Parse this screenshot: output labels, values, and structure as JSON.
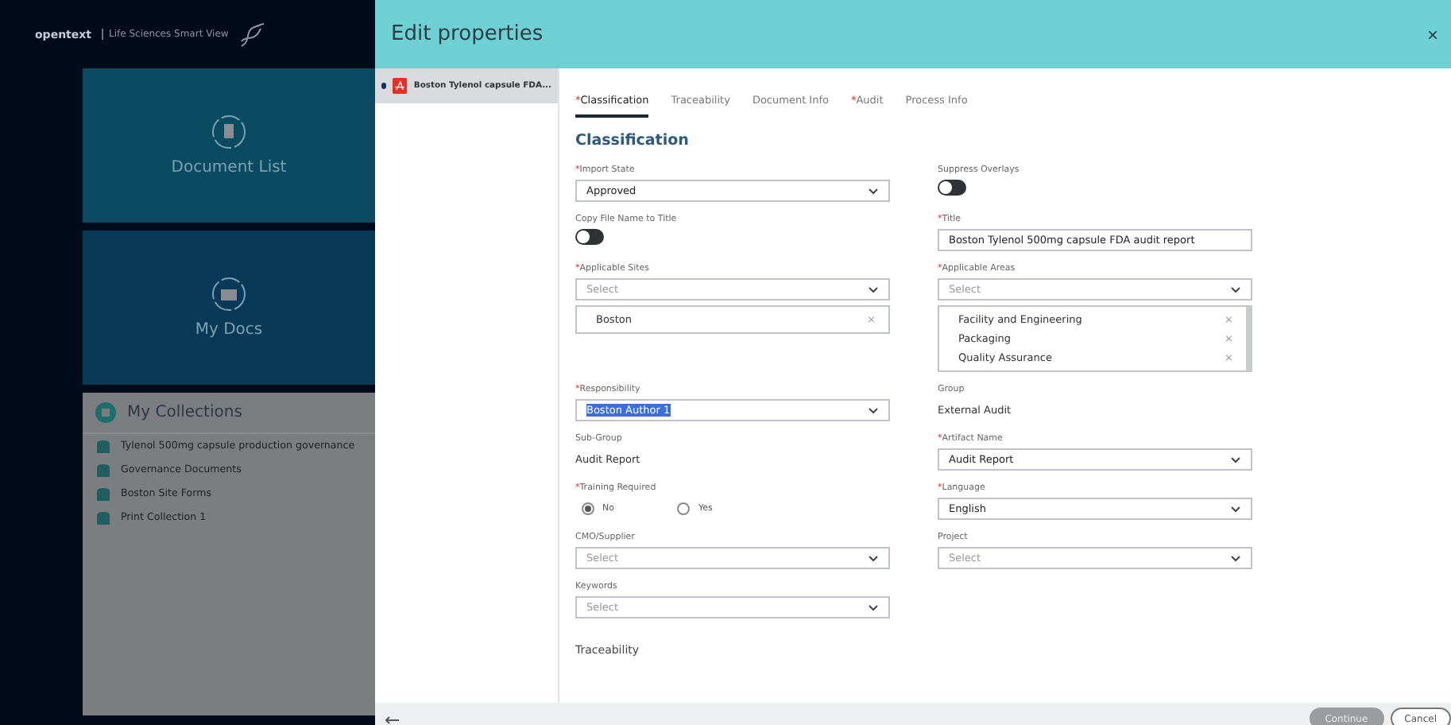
{
  "app": {
    "brand": "opentext",
    "product": "Life Sciences Smart View",
    "tiles": [
      {
        "label": "Document List",
        "kind": "list"
      },
      {
        "label": "My Docs",
        "kind": "folder"
      }
    ],
    "collections": {
      "title": "My Collections",
      "items": [
        "Tylenol 500mg capsule production governance",
        "Governance Documents",
        "Boston Site Forms",
        "Print Collection 1"
      ]
    }
  },
  "dialog": {
    "title": "Edit properties",
    "close": "×",
    "documents": [
      {
        "name": "Boston Tylenol capsule FDA...",
        "selected": true
      }
    ],
    "tabs": [
      {
        "mark": "*",
        "label": "Classification",
        "selected": true
      },
      {
        "label": "Traceability",
        "selected": false
      },
      {
        "label": "Document Info",
        "selected": false
      },
      {
        "mark": "*",
        "label": "Audit",
        "selected": false
      },
      {
        "label": "Process Info",
        "selected": false
      }
    ],
    "heading": "Classification",
    "rows": [
      [
        {
          "kind": "select",
          "mark": "*",
          "label": "Import State",
          "value": "Approved"
        },
        {
          "kind": "toggle",
          "label": "Suppress Overlays",
          "on": false
        }
      ],
      [
        {
          "kind": "toggle",
          "label": "Copy File Name to Title",
          "on": false
        },
        {
          "kind": "input",
          "mark": "*",
          "label": "Title",
          "value": "Boston Tylenol 500mg capsule FDA audit report"
        }
      ],
      [
        {
          "kind": "multi",
          "mark": "*",
          "label": "Applicable Sites",
          "placeholder": "Select",
          "chips": [
            {
              "label": "Boston",
              "remove": "×"
            }
          ]
        },
        {
          "kind": "multi",
          "mark": "*",
          "label": "Applicable Areas",
          "placeholder": "Select",
          "chips": [
            {
              "label": "Facility and Engineering",
              "remove": "×"
            },
            {
              "label": "Packaging",
              "remove": "×"
            },
            {
              "label": "Quality Assurance",
              "remove": "×"
            }
          ]
        }
      ],
      [
        {
          "kind": "select",
          "mark": "*",
          "label": "Responsibility",
          "value": "Boston Author 1",
          "highlighted": true
        },
        {
          "kind": "text",
          "label": "Group",
          "value": "External Audit"
        }
      ],
      [
        {
          "kind": "text",
          "label": "Sub-Group",
          "value": "Audit Report"
        },
        {
          "kind": "select",
          "mark": "*",
          "label": "Artifact Name",
          "value": "Audit Report"
        }
      ],
      [
        {
          "kind": "radio",
          "mark": "*",
          "label": "Training Required",
          "options": [
            {
              "label": "No",
              "selected": true
            },
            {
              "label": "Yes",
              "selected": false
            }
          ]
        },
        {
          "kind": "select",
          "mark": "*",
          "label": "Language",
          "value": "English"
        }
      ],
      [
        {
          "kind": "select",
          "label": "CMO/Supplier",
          "placeholder": "Select"
        },
        {
          "kind": "select",
          "label": "Project",
          "placeholder": "Select"
        }
      ],
      [
        {
          "kind": "select",
          "label": "Keywords",
          "placeholder": "Select"
        }
      ]
    ],
    "section": "Traceability",
    "footer": {
      "continue": "Continue",
      "continue_disabled": true,
      "cancel": "Cancel"
    }
  }
}
